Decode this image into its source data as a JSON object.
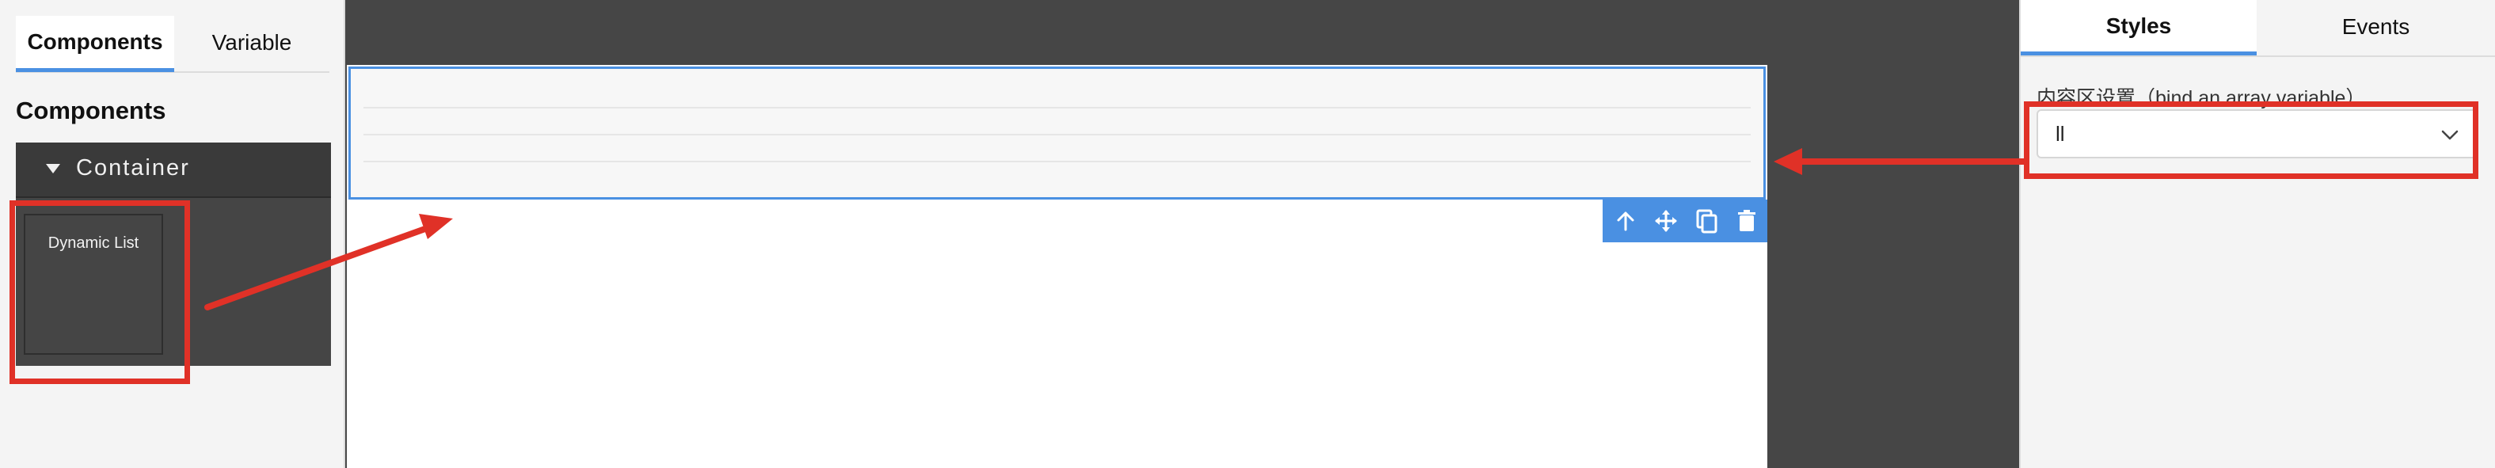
{
  "left_panel": {
    "tabs": [
      {
        "label": "Components",
        "active": true
      },
      {
        "label": "Variable",
        "active": false
      }
    ],
    "heading": "Components",
    "group": {
      "label": "Container",
      "items": [
        {
          "label": "Dynamic List"
        }
      ]
    }
  },
  "canvas": {
    "selected_component_rows": 4,
    "toolbar": {
      "icons": [
        "arrow-up-icon",
        "move-icon",
        "copy-icon",
        "delete-icon"
      ]
    }
  },
  "right_panel": {
    "tabs": [
      {
        "label": "Styles",
        "active": true
      },
      {
        "label": "Events",
        "active": false
      }
    ],
    "property_label": "内容区设置（bind an array variable）",
    "select_value": "ll"
  },
  "colors": {
    "accent": "#4a90e2",
    "annotation_red": "#e03127",
    "canvas_dark": "#464646"
  }
}
